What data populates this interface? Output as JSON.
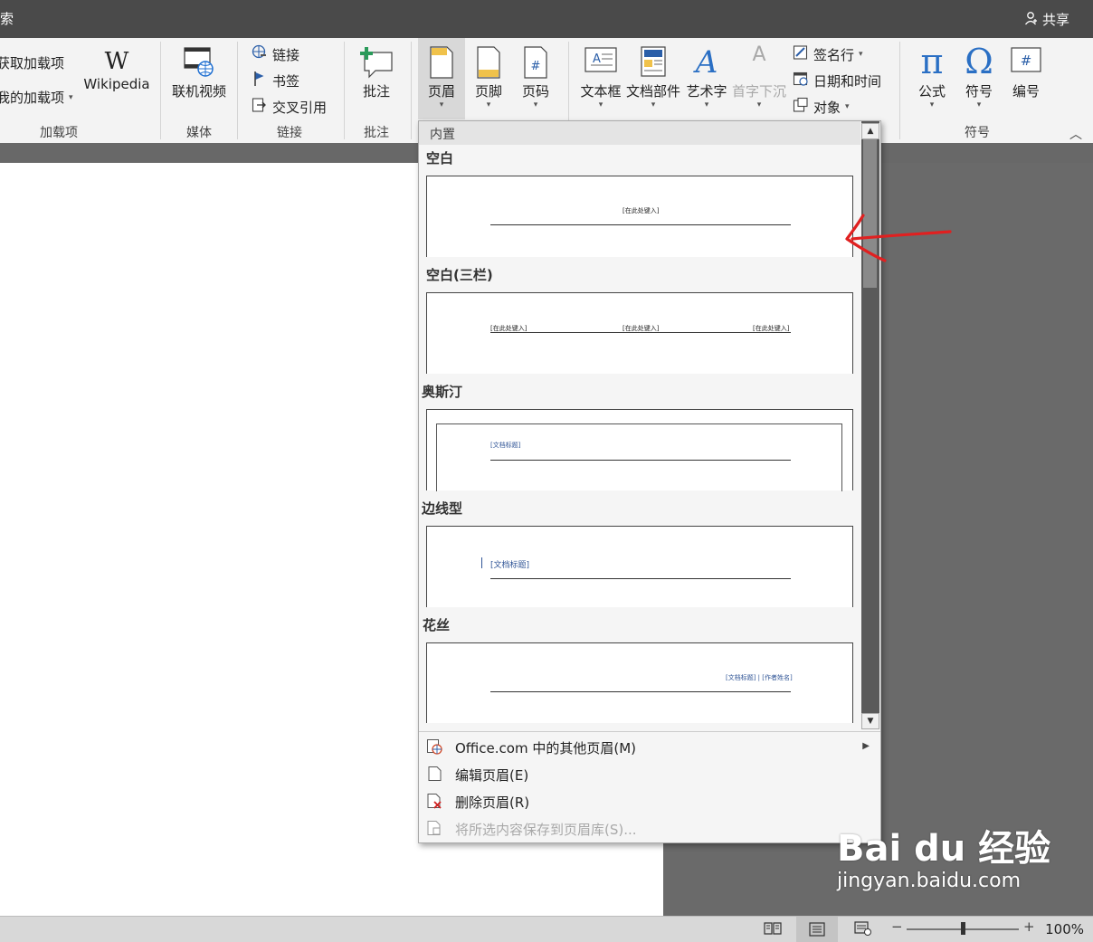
{
  "titlebar": {
    "title_fragment": "索",
    "share_label": "共享"
  },
  "ribbon": {
    "addins": {
      "get_addins": "获取加载项",
      "my_addins": "我的加载项",
      "wikipedia": "Wikipedia",
      "group_label": "加载项"
    },
    "media": {
      "online_video": "联机视频",
      "group_label": "媒体"
    },
    "links": {
      "link": "链接",
      "bookmark": "书签",
      "cross_reference": "交叉引用",
      "group_label": "链接"
    },
    "comments": {
      "comment": "批注",
      "group_label": "批注"
    },
    "header_footer": {
      "header": "页眉",
      "footer": "页脚",
      "page_number": "页码"
    },
    "text": {
      "text_box": "文本框",
      "quick_parts": "文档部件",
      "wordart": "艺术字",
      "drop_cap": "首字下沉",
      "signature_line": "签名行",
      "date_time": "日期和时间",
      "object": "对象"
    },
    "symbols": {
      "equation": "公式",
      "symbol": "符号",
      "number": "编号",
      "group_label": "符号"
    }
  },
  "dropdown": {
    "section_header": "内置",
    "items": [
      {
        "name": "空白",
        "placeholders": [
          "[在此处键入]"
        ]
      },
      {
        "name": "空白(三栏)",
        "placeholders": [
          "[在此处键入]",
          "[在此处键入]",
          "[在此处键入]"
        ]
      },
      {
        "name": "奥斯汀",
        "placeholders": [
          "[文档标题]"
        ]
      },
      {
        "name": "边线型",
        "placeholders": [
          "[文档标题]"
        ]
      },
      {
        "name": "花丝",
        "placeholders": [
          "[文档标题] | [作者姓名]"
        ]
      }
    ],
    "menu": [
      {
        "label": "Office.com 中的其他页眉(M)",
        "has_submenu": true,
        "enabled": true
      },
      {
        "label": "编辑页眉(E)",
        "enabled": true
      },
      {
        "label": "删除页眉(R)",
        "enabled": true
      },
      {
        "label": "将所选内容保存到页眉库(S)...",
        "enabled": false
      }
    ]
  },
  "statusbar": {
    "zoom_level": "100%"
  },
  "watermark": {
    "brand": "Bai du 经验",
    "url": "jingyan.baidu.com"
  },
  "colors": {
    "accent_blue": "#2f5496",
    "annotation_red": "#e02020"
  }
}
